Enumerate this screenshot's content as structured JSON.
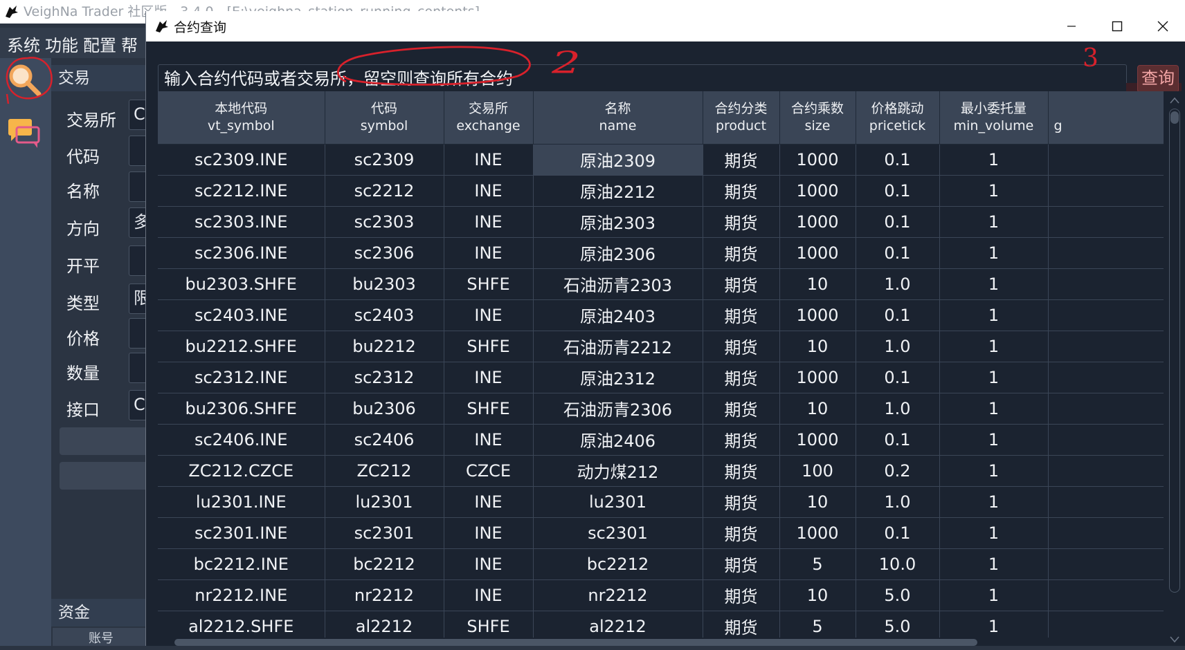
{
  "main_window": {
    "title": "VeighNa Trader 社区版 - 3.4.0 - [E:\\veighna_station_running_contents]",
    "menu": [
      "系统",
      "功能",
      "配置",
      "帮"
    ],
    "trade_dock_title": "交易",
    "form_labels": [
      "交易所",
      "代码",
      "名称",
      "方向",
      "开平",
      "类型",
      "价格",
      "数量",
      "接口"
    ],
    "form_values": [
      "C",
      "",
      "",
      "多",
      "",
      "限",
      "",
      "",
      "C"
    ],
    "funds_dock_title": "资金",
    "funds_header": "账号"
  },
  "dialog": {
    "title": "合约查询",
    "search_placeholder": "输入合约代码或者交易所，留空则查询所有合约",
    "query_button": "查询",
    "columns": [
      {
        "cn": "本地代码",
        "en": "vt_symbol"
      },
      {
        "cn": "代码",
        "en": "symbol"
      },
      {
        "cn": "交易所",
        "en": "exchange"
      },
      {
        "cn": "名称",
        "en": "name"
      },
      {
        "cn": "合约分类",
        "en": "product"
      },
      {
        "cn": "合约乘数",
        "en": "size"
      },
      {
        "cn": "价格跳动",
        "en": "pricetick"
      },
      {
        "cn": "最小委托量",
        "en": "min_volume"
      },
      {
        "cn": "",
        "en": "g"
      }
    ],
    "rows": [
      [
        "sc2309.INE",
        "sc2309",
        "INE",
        "原油2309",
        "期货",
        "1000",
        "0.1",
        "1"
      ],
      [
        "sc2212.INE",
        "sc2212",
        "INE",
        "原油2212",
        "期货",
        "1000",
        "0.1",
        "1"
      ],
      [
        "sc2303.INE",
        "sc2303",
        "INE",
        "原油2303",
        "期货",
        "1000",
        "0.1",
        "1"
      ],
      [
        "sc2306.INE",
        "sc2306",
        "INE",
        "原油2306",
        "期货",
        "1000",
        "0.1",
        "1"
      ],
      [
        "bu2303.SHFE",
        "bu2303",
        "SHFE",
        "石油沥青2303",
        "期货",
        "10",
        "1.0",
        "1"
      ],
      [
        "sc2403.INE",
        "sc2403",
        "INE",
        "原油2403",
        "期货",
        "1000",
        "0.1",
        "1"
      ],
      [
        "bu2212.SHFE",
        "bu2212",
        "SHFE",
        "石油沥青2212",
        "期货",
        "10",
        "1.0",
        "1"
      ],
      [
        "sc2312.INE",
        "sc2312",
        "INE",
        "原油2312",
        "期货",
        "1000",
        "0.1",
        "1"
      ],
      [
        "bu2306.SHFE",
        "bu2306",
        "SHFE",
        "石油沥青2306",
        "期货",
        "10",
        "1.0",
        "1"
      ],
      [
        "sc2406.INE",
        "sc2406",
        "INE",
        "原油2406",
        "期货",
        "1000",
        "0.1",
        "1"
      ],
      [
        "ZC212.CZCE",
        "ZC212",
        "CZCE",
        "动力煤212",
        "期货",
        "100",
        "0.2",
        "1"
      ],
      [
        "lu2301.INE",
        "lu2301",
        "INE",
        "lu2301",
        "期货",
        "10",
        "1.0",
        "1"
      ],
      [
        "sc2301.INE",
        "sc2301",
        "INE",
        "sc2301",
        "期货",
        "1000",
        "0.1",
        "1"
      ],
      [
        "bc2212.INE",
        "bc2212",
        "INE",
        "bc2212",
        "期货",
        "5",
        "10.0",
        "1"
      ],
      [
        "nr2212.INE",
        "nr2212",
        "INE",
        "nr2212",
        "期货",
        "10",
        "5.0",
        "1"
      ],
      [
        "al2212.SHFE",
        "al2212",
        "SHFE",
        "al2212",
        "期货",
        "5",
        "5.0",
        "1"
      ]
    ]
  },
  "annotations": {
    "step2": "2",
    "step3": "3"
  },
  "colors": {
    "accent_red": "#d8212b",
    "header_bg": "#3a4556",
    "table_bg": "#1b2330"
  }
}
